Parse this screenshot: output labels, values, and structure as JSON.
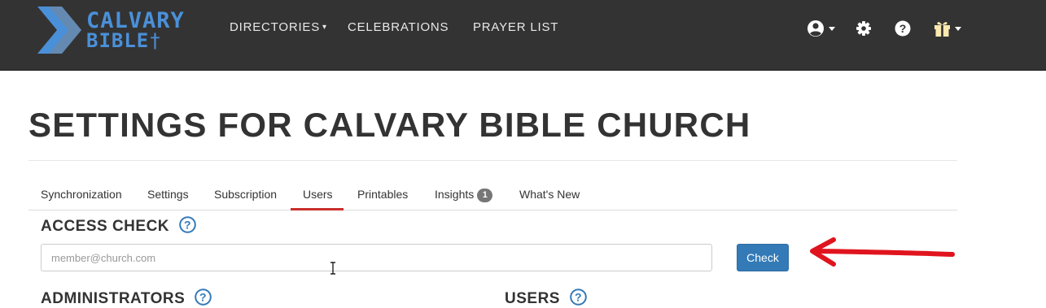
{
  "brand": {
    "line1": "CALVARY",
    "line2": "BIBLE",
    "cross": "†"
  },
  "nav": {
    "directories": "DIRECTORIES",
    "celebrations": "CELEBRATIONS",
    "prayer_list": "PRAYER LIST",
    "caret": "▾"
  },
  "topbar_icons": [
    "user-circle-icon",
    "gear-icon",
    "question-circle-icon",
    "gift-icon"
  ],
  "page": {
    "title": "SETTINGS FOR CALVARY BIBLE CHURCH"
  },
  "tabs": [
    {
      "label": "Synchronization"
    },
    {
      "label": "Settings"
    },
    {
      "label": "Subscription"
    },
    {
      "label": "Users",
      "active": true
    },
    {
      "label": "Printables"
    },
    {
      "label": "Insights",
      "badge": "1"
    },
    {
      "label": "What's New"
    }
  ],
  "access_check": {
    "heading": "ACCESS CHECK",
    "placeholder": "member@church.com",
    "button": "Check"
  },
  "sections": {
    "administrators": "ADMINISTRATORS",
    "users": "USERS"
  },
  "colors": {
    "topbar": "#333333",
    "brand": "#4a90d9",
    "accent": "#c9302c",
    "button": "#337ab7",
    "help": "#337ab7"
  }
}
